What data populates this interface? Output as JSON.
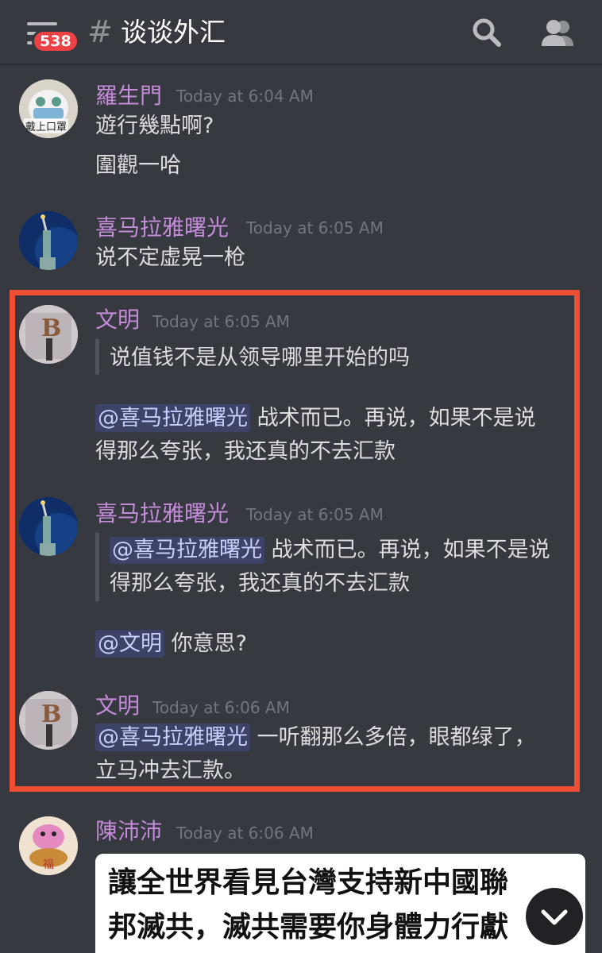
{
  "header": {
    "unread_badge": "538",
    "hash": "#",
    "channel_title": "谈谈外汇",
    "icons": [
      "menu-icon",
      "search-icon",
      "members-icon"
    ]
  },
  "highlight_color": "#ee4e31",
  "messages": [
    {
      "author": "羅生門",
      "timestamp": "Today at 6:04 AM",
      "lines": [
        "遊行幾點啊?",
        "圍觀一哈"
      ],
      "avatar_text": "戴上口罩"
    },
    {
      "author": "喜马拉雅曙光",
      "timestamp": "Today at 6:05 AM",
      "lines": [
        "说不定虚晃一枪"
      ]
    },
    {
      "author": "文明",
      "timestamp": "Today at 6:05 AM",
      "avatar_letter": "B",
      "quote": "说值钱不是从领导哪里开始的吗",
      "mention": "@喜马拉雅曙光",
      "reply_line1": "战术而已。再说，如果不是说",
      "reply_line2": "得那么夸张，我还真的不去汇款"
    },
    {
      "author": "喜马拉雅曙光",
      "timestamp": "Today at 6:05 AM",
      "quote_mention": "@喜马拉雅曙光",
      "quote_line1": "战术而已。再说，如果不是说",
      "quote_line2": "得那么夸张，我还真的不去汇款",
      "mention": "@文明",
      "reply": "你意思?"
    },
    {
      "author": "文明",
      "timestamp": "Today at 6:06 AM",
      "avatar_letter": "B",
      "mention": "@喜马拉雅曙光",
      "reply_line1": "一听翻那么多倍，眼都绿了，",
      "reply_line2": "立马冲去汇款。"
    },
    {
      "author": "陳沛沛",
      "timestamp": "Today at 6:06 AM",
      "avatar_text": "福",
      "image_line1": "讓全世界看見台灣支持新中國聯",
      "image_line2": "邦滅共，滅共需要你身體力行獻"
    }
  ]
}
